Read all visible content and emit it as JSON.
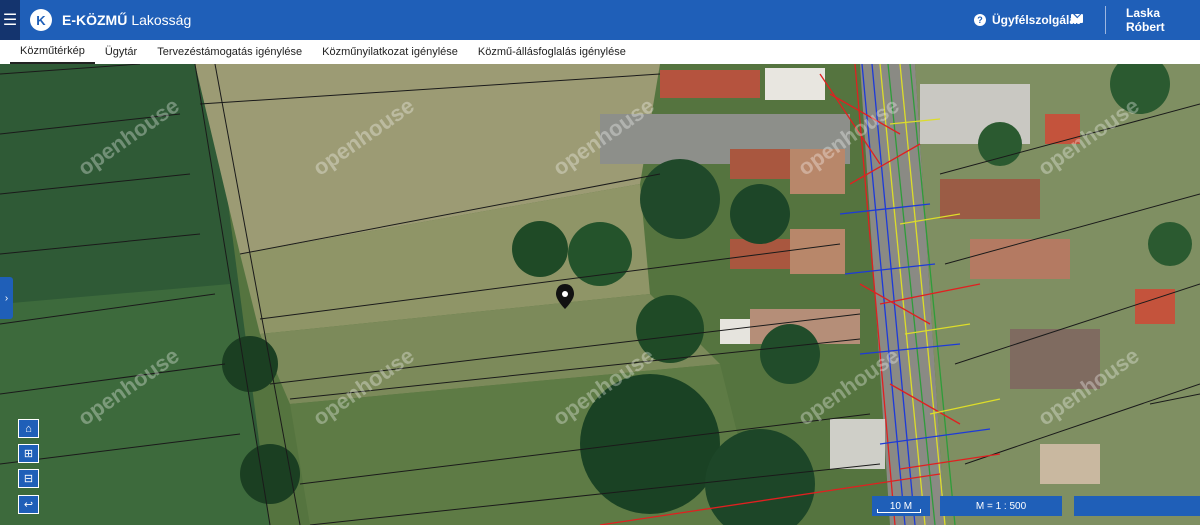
{
  "app": {
    "brand": "E-KÖZMŰ",
    "section": "Lakosság",
    "logo_letter": "K",
    "support_label": "Ügyfélszolgálat",
    "user_name": "Laska Róbert",
    "accent": "#1f5fb8"
  },
  "tabs": [
    {
      "label": "Közműtérkép",
      "active": true
    },
    {
      "label": "Ügytár"
    },
    {
      "label": "Tervezéstámogatás igénylése"
    },
    {
      "label": "Közműnyilatkozat igénylése"
    },
    {
      "label": "Közmű-állásfoglalás igénylése"
    }
  ],
  "map": {
    "watermark": "openhouse",
    "scale_text": "10 M",
    "ratio_text": "M = 1 : 500",
    "controls": [
      "home-icon",
      "zoom-in-icon",
      "zoom-out-icon",
      "undo-icon"
    ]
  }
}
